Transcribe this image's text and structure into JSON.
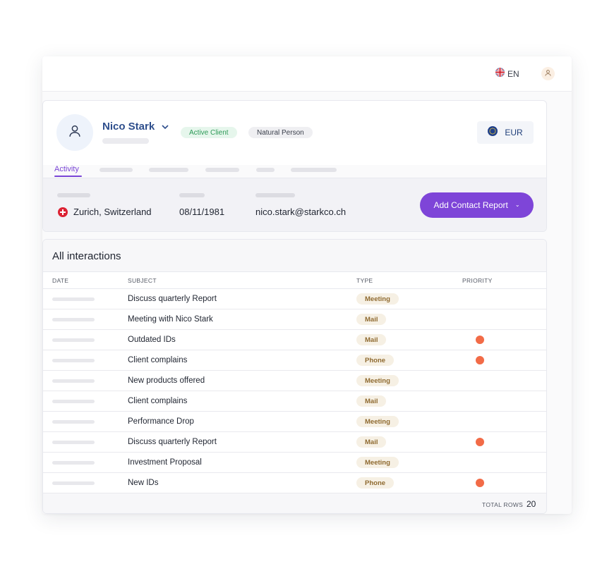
{
  "topbar": {
    "language": "EN",
    "flag_icon": "uk-flag-icon",
    "user_icon": "user-icon"
  },
  "client": {
    "name": "Nico Stark",
    "status_badge": "Active Client",
    "type_badge": "Natural Person",
    "currency": "EUR",
    "currency_icon": "eu-flag-icon"
  },
  "tabs": {
    "active": "Activity"
  },
  "details": {
    "location": "Zurich, Switzerland",
    "location_flag_icon": "swiss-flag-icon",
    "birth_date": "08/11/1981",
    "email": "nico.stark@starkco.ch"
  },
  "actions": {
    "add_contact_report": "Add Contact Report",
    "chevron_icon": "chevron-down-icon"
  },
  "interactions": {
    "title": "All interactions",
    "columns": [
      "DATE",
      "SUBJECT",
      "TYPE",
      "PRIORITY"
    ],
    "rows": [
      {
        "subject": "Discuss quarterly Report",
        "type": "Meeting",
        "priority": false
      },
      {
        "subject": "Meeting with Nico Stark",
        "type": "Mail",
        "priority": false
      },
      {
        "subject": "Outdated IDs",
        "type": "Mail",
        "priority": true
      },
      {
        "subject": "Client complains",
        "type": "Phone",
        "priority": true
      },
      {
        "subject": "New products offered",
        "type": "Meeting",
        "priority": false
      },
      {
        "subject": "Client complains",
        "type": "Mail",
        "priority": false
      },
      {
        "subject": "Performance Drop",
        "type": "Meeting",
        "priority": false
      },
      {
        "subject": "Discuss quarterly Report",
        "type": "Mail",
        "priority": true
      },
      {
        "subject": "Investment Proposal",
        "type": "Meeting",
        "priority": false
      },
      {
        "subject": "New IDs",
        "type": "Phone",
        "priority": true
      }
    ],
    "total_rows_label": "TOTAL ROWS",
    "total_rows": "20"
  },
  "colors": {
    "accent_purple": "#7e45d8",
    "name_blue": "#2e4e8c",
    "active_green": "#2e9a58",
    "priority_orange": "#f26b47",
    "type_pill_bg": "#f6f0e4",
    "type_pill_text": "#8f6a30"
  }
}
